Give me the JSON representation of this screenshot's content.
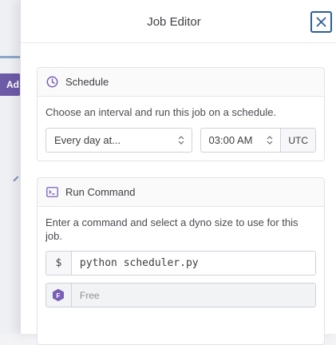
{
  "background": {
    "partial_button_label": "Ad"
  },
  "modal": {
    "title": "Job Editor",
    "schedule": {
      "heading": "Schedule",
      "description": "Choose an interval and run this job on a schedule.",
      "interval_value": "Every day at...",
      "time_value": "03:00 AM",
      "timezone": "UTC"
    },
    "run_command": {
      "heading": "Run Command",
      "description": "Enter a command and select a dyno size to use for this job.",
      "prompt_symbol": "$",
      "command_value": "python scheduler.py",
      "dyno_badge": "F",
      "dyno_size": "Free"
    }
  },
  "colors": {
    "accent_purple": "#7a5fb8",
    "close_border": "#2e5f97"
  },
  "icons": {
    "close": "close-icon",
    "schedule": "clock-icon",
    "run_command": "terminal-icon",
    "select_arrows": "chevron-up-down-icon",
    "dyno": "dyno-free-icon"
  }
}
